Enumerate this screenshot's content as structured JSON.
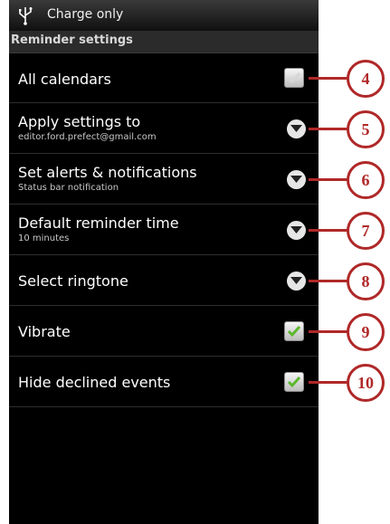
{
  "status_bar": {
    "text": "Charge only",
    "icon": "usb-icon"
  },
  "section_header": "Reminder settings",
  "rows": [
    {
      "title": "All calendars",
      "subtitle": "",
      "control": "checkbox",
      "checked": true,
      "control_state": "dimmed"
    },
    {
      "title": "Apply settings to",
      "subtitle": "editor.ford.prefect@gmail.com",
      "control": "dropdown"
    },
    {
      "title": "Set alerts & notifications",
      "subtitle": "Status bar notification",
      "control": "dropdown"
    },
    {
      "title": "Default reminder time",
      "subtitle": "10 minutes",
      "control": "dropdown"
    },
    {
      "title": "Select ringtone",
      "subtitle": "",
      "control": "dropdown"
    },
    {
      "title": "Vibrate",
      "subtitle": "",
      "control": "checkbox",
      "checked": true
    },
    {
      "title": "Hide declined events",
      "subtitle": "",
      "control": "checkbox",
      "checked": true
    }
  ],
  "callouts": [
    "4",
    "5",
    "6",
    "7",
    "8",
    "9",
    "10"
  ],
  "colors": {
    "callout": "#b02828",
    "check": "#5cb82e",
    "check_dimmed": "#d6d6d6"
  }
}
